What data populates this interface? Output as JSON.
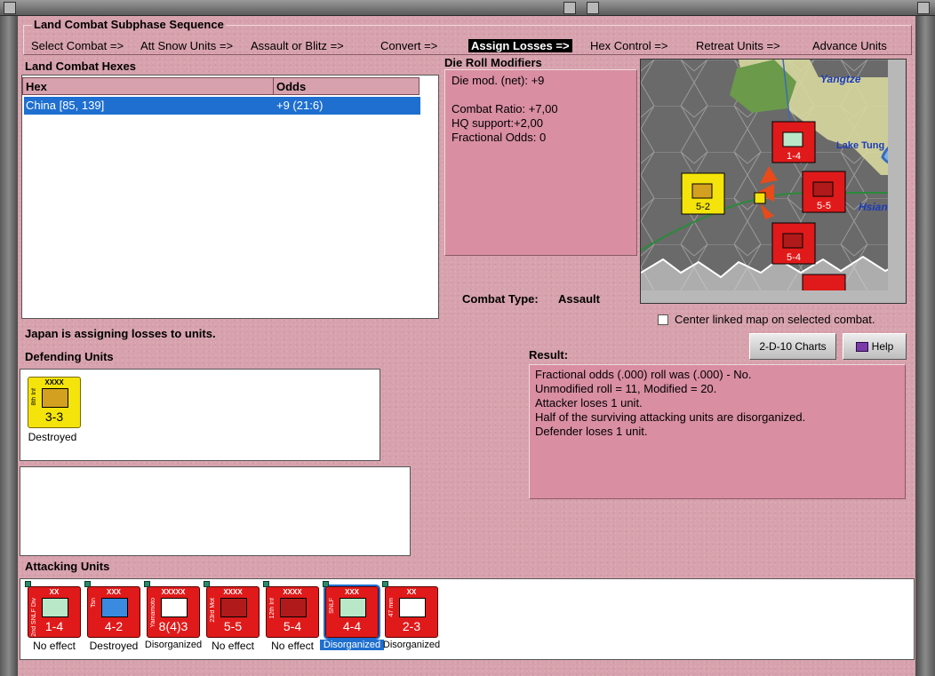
{
  "subphase": {
    "title": "Land Combat Subphase Sequence",
    "steps": [
      "Select Combat =>",
      "Att Snow Units =>",
      "Assault or Blitz =>",
      "Convert =>",
      "Assign Losses =>",
      "Hex Control =>",
      "Retreat Units =>",
      "Advance Units"
    ],
    "active_step": "Assign Losses =>"
  },
  "combat_hexes": {
    "title": "Land Combat Hexes",
    "columns": [
      "Hex",
      "Odds"
    ],
    "rows": [
      {
        "hex": "China [85, 139]",
        "odds": "+9 (21:6)"
      }
    ]
  },
  "die_roll": {
    "title": "Die Roll Modifiers",
    "lines": [
      "Die mod. (net): +9",
      "",
      "Combat Ratio: +7,00",
      "HQ support:+2,00",
      "Fractional Odds: 0"
    ]
  },
  "combat_type": {
    "label": "Combat Type:",
    "value": "Assault"
  },
  "map": {
    "labels": [
      "Yangtze",
      "Lake Tung",
      "Hsian"
    ]
  },
  "center_map_label": "Center linked map on selected combat.",
  "buttons": {
    "charts": "2-D-10 Charts",
    "help": "Help"
  },
  "status_text": "Japan is assigning losses to units.",
  "defending": {
    "title": "Defending Units",
    "units": [
      {
        "name": "8th Inf",
        "size": "XXXX",
        "strength": "3-3",
        "effect": "Destroyed"
      }
    ]
  },
  "result": {
    "title": "Result:",
    "lines": [
      "Fractional odds (.000) roll was (.000)  - No.",
      "Unmodified roll = 11, Modified = 20.",
      "Attacker loses 1 unit.",
      "Half of the surviving attacking units are disorganized.",
      "Defender loses 1 unit."
    ]
  },
  "attacking": {
    "title": "Attacking Units",
    "units": [
      {
        "name": "2nd SNLF Div",
        "size": "XX",
        "strength": "1-4",
        "effect": "No effect"
      },
      {
        "name": "Tsn",
        "size": "XXX",
        "strength": "4-2",
        "effect": "Destroyed"
      },
      {
        "name": "Yamamoto",
        "size": "XXXXX",
        "strength": "8(4)3",
        "effect": "Disorganized"
      },
      {
        "name": "23rd Mot",
        "size": "XXXX",
        "strength": "5-5",
        "effect": "No effect"
      },
      {
        "name": "12th Inf",
        "size": "XXXX",
        "strength": "5-4",
        "effect": "No effect"
      },
      {
        "name": "SNLF",
        "size": "XXX",
        "strength": "4-4",
        "effect": "Disorganized"
      },
      {
        "name": "47 mm",
        "size": "XX",
        "strength": "2-3",
        "effect": "Disorganized"
      }
    ]
  },
  "colors": {
    "panel": "#d7a2ad",
    "selection": "#1e6fd0",
    "counter_red": "#e01a1a",
    "counter_yellow": "#f4e40b"
  }
}
